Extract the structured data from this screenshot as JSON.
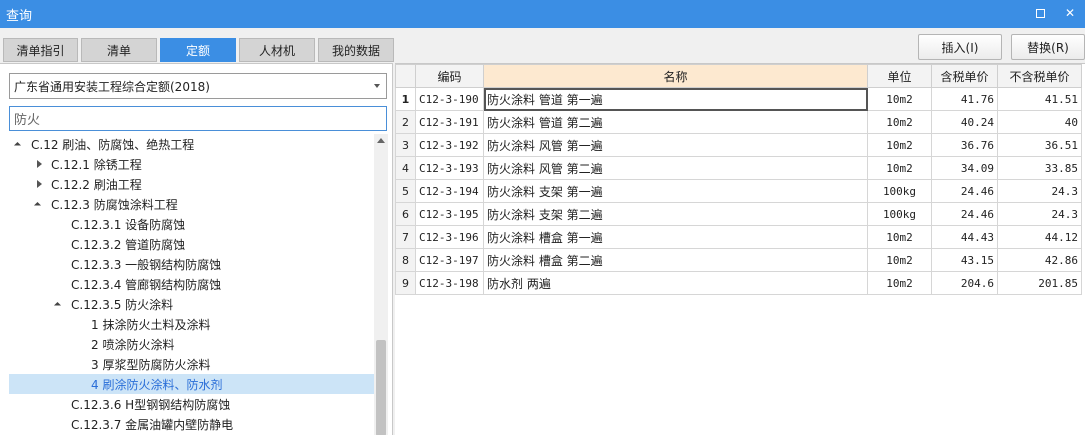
{
  "window": {
    "title": "查询"
  },
  "tabs": [
    {
      "label": "清单指引",
      "active": false
    },
    {
      "label": "清单",
      "active": false
    },
    {
      "label": "定额",
      "active": true
    },
    {
      "label": "人材机",
      "active": false
    },
    {
      "label": "我的数据",
      "active": false
    }
  ],
  "actions": {
    "insert": "插入(I)",
    "replace": "替换(R)"
  },
  "quota_select": {
    "value": "广东省通用安装工程综合定额(2018)"
  },
  "search": {
    "value": "防火"
  },
  "tree": [
    {
      "label": "C.12 刷油、防腐蚀、绝热工程",
      "level": 0,
      "state": "expanded"
    },
    {
      "label": "C.12.1 除锈工程",
      "level": 1,
      "state": "collapsed"
    },
    {
      "label": "C.12.2 刷油工程",
      "level": 1,
      "state": "collapsed"
    },
    {
      "label": "C.12.3 防腐蚀涂料工程",
      "level": 1,
      "state": "expanded"
    },
    {
      "label": "C.12.3.1 设备防腐蚀",
      "level": 2,
      "state": "leaf"
    },
    {
      "label": "C.12.3.2 管道防腐蚀",
      "level": 2,
      "state": "leaf"
    },
    {
      "label": "C.12.3.3 一般钢结构防腐蚀",
      "level": 2,
      "state": "leaf"
    },
    {
      "label": "C.12.3.4 管廊钢结构防腐蚀",
      "level": 2,
      "state": "leaf"
    },
    {
      "label": "C.12.3.5 防火涂料",
      "level": 2,
      "state": "expanded"
    },
    {
      "label": "1 抹涂防火土料及涂料",
      "level": 3,
      "state": "leaf"
    },
    {
      "label": "2 喷涂防火涂料",
      "level": 3,
      "state": "leaf"
    },
    {
      "label": "3 厚浆型防腐防火涂料",
      "level": 3,
      "state": "leaf"
    },
    {
      "label": "4 刷涂防火涂料、防水剂",
      "level": 3,
      "state": "leaf",
      "selected": true
    },
    {
      "label": "C.12.3.6 H型钢钢结构防腐蚀",
      "level": 2,
      "state": "leaf"
    },
    {
      "label": "C.12.3.7 金属油罐内壁防静电",
      "level": 2,
      "state": "leaf"
    }
  ],
  "table": {
    "headers": [
      "",
      "编码",
      "名称",
      "单位",
      "含税单价",
      "不含税单价"
    ],
    "rows": [
      [
        "1",
        "C12-3-190",
        "防火涂料 管道 第一遍",
        "10m2",
        "41.76",
        "41.51"
      ],
      [
        "2",
        "C12-3-191",
        "防火涂料 管道 第二遍",
        "10m2",
        "40.24",
        "40"
      ],
      [
        "3",
        "C12-3-192",
        "防火涂料 风管 第一遍",
        "10m2",
        "36.76",
        "36.51"
      ],
      [
        "4",
        "C12-3-193",
        "防火涂料 风管 第二遍",
        "10m2",
        "34.09",
        "33.85"
      ],
      [
        "5",
        "C12-3-194",
        "防火涂料 支架 第一遍",
        "100kg",
        "24.46",
        "24.3"
      ],
      [
        "6",
        "C12-3-195",
        "防火涂料 支架 第二遍",
        "100kg",
        "24.46",
        "24.3"
      ],
      [
        "7",
        "C12-3-196",
        "防火涂料 槽盒 第一遍",
        "10m2",
        "44.43",
        "44.12"
      ],
      [
        "8",
        "C12-3-197",
        "防火涂料 槽盒 第二遍",
        "10m2",
        "43.15",
        "42.86"
      ],
      [
        "9",
        "C12-3-198",
        "防水剂 两遍",
        "10m2",
        "204.6",
        "201.85"
      ]
    ]
  },
  "colors": {
    "titlebar": "#3b8ee4",
    "tab_active": "#3b8ee4",
    "name_header": "#fde9d0",
    "tree_selected": "#cce4f7"
  }
}
